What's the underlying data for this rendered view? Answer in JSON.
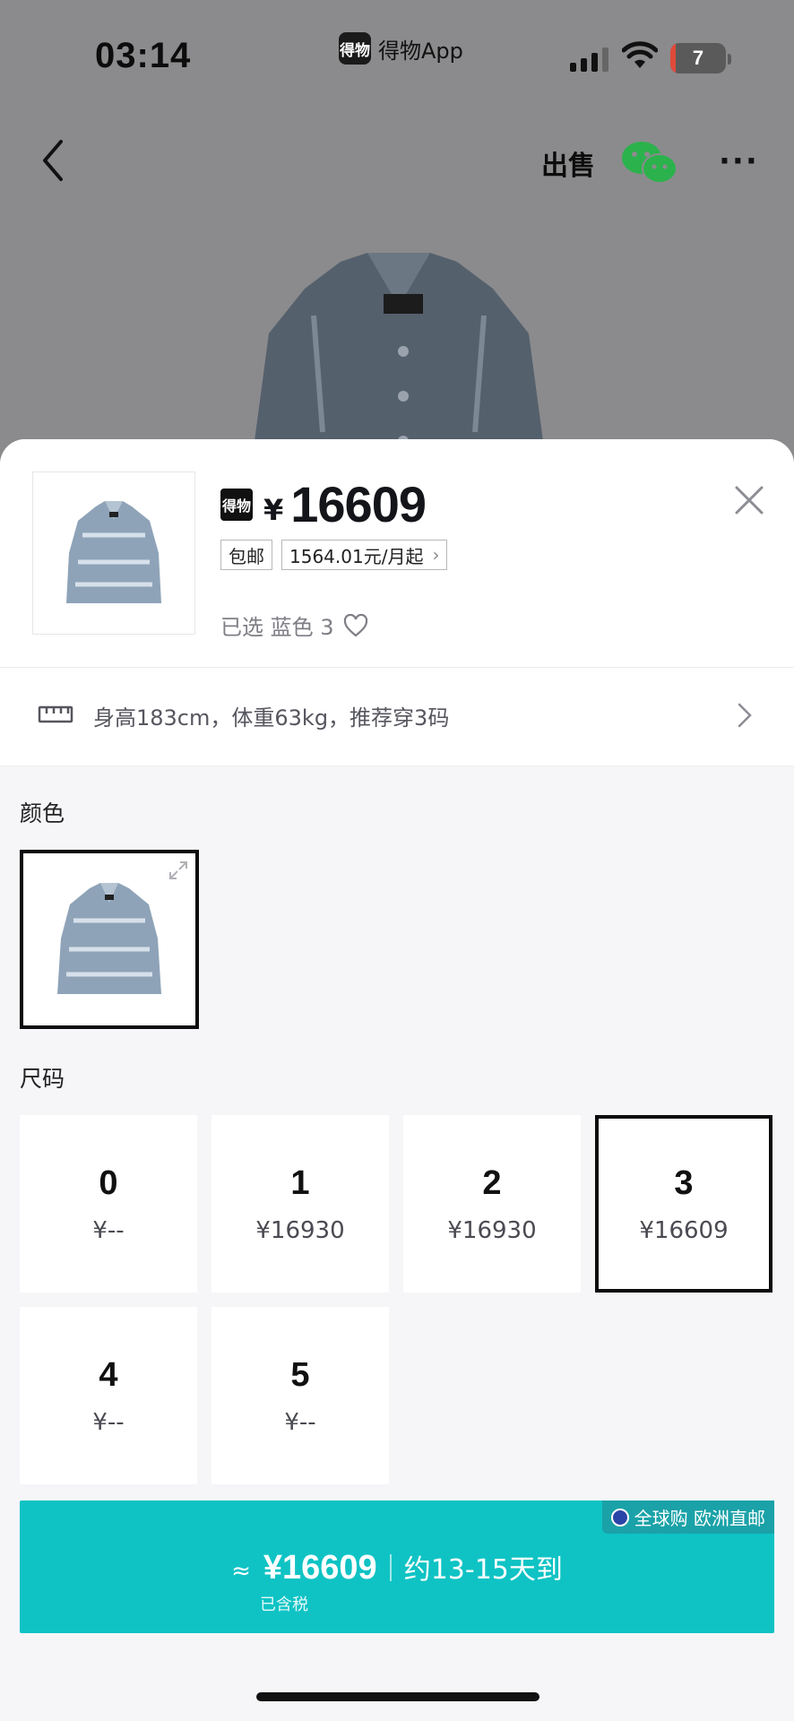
{
  "status_bar": {
    "time": "03:14",
    "app_name": "得物App",
    "app_logo_text": "得物",
    "battery": "7"
  },
  "topbar": {
    "sell_label": "出售"
  },
  "sheet": {
    "logo_text": "得物",
    "currency": "¥",
    "price": "16609",
    "tags": {
      "free_shipping": "包邮",
      "installment": "1564.01元/月起"
    },
    "selected_text": "已选 蓝色 3",
    "fit_recommendation": "身高183cm，体重63kg，推荐穿3码",
    "color_label": "颜色",
    "size_label": "尺码",
    "sizes": [
      {
        "size": "0",
        "price": "¥--"
      },
      {
        "size": "1",
        "price": "¥16930"
      },
      {
        "size": "2",
        "price": "¥16930"
      },
      {
        "size": "3",
        "price": "¥16609"
      },
      {
        "size": "4",
        "price": "¥--"
      },
      {
        "size": "5",
        "price": "¥--"
      }
    ],
    "selected_size_index": 3
  },
  "buy_button": {
    "badge": "全球购 欧洲直邮",
    "approx": "≈",
    "price": "¥16609",
    "eta": "约13-15天到",
    "tax_note": "已含税"
  },
  "colors": {
    "accent": "#0fc3c4",
    "badge": "#1aa2a8",
    "backdrop": "#8b8b8d"
  }
}
